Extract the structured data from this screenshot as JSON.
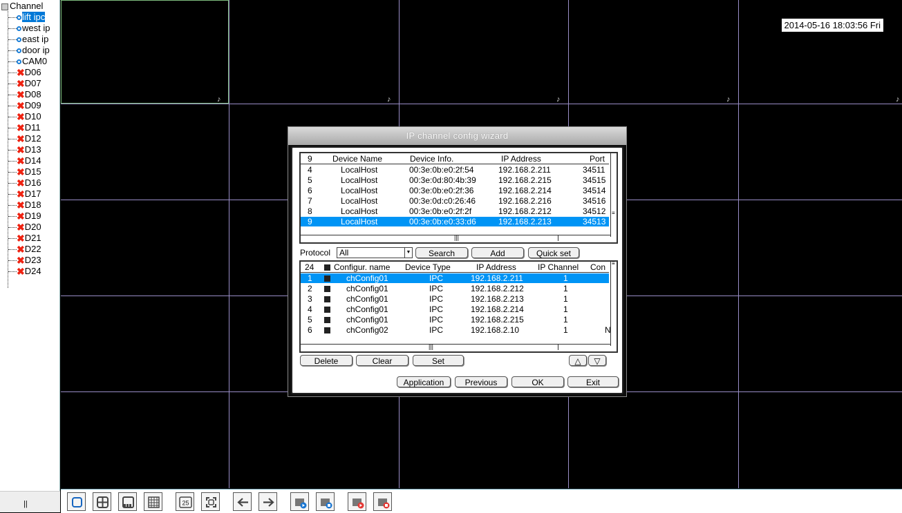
{
  "sidebar": {
    "root_label": "Channel",
    "channels": [
      {
        "label": "lift ipc",
        "type": "ipc",
        "selected": true
      },
      {
        "label": "west ip",
        "type": "ipc"
      },
      {
        "label": "east ip",
        "type": "ipc"
      },
      {
        "label": "door ip",
        "type": "ipc"
      },
      {
        "label": "CAM0",
        "type": "ipc"
      },
      {
        "label": "D06",
        "type": "off"
      },
      {
        "label": "D07",
        "type": "off"
      },
      {
        "label": "D08",
        "type": "off"
      },
      {
        "label": "D09",
        "type": "off"
      },
      {
        "label": "D10",
        "type": "off"
      },
      {
        "label": "D11",
        "type": "off"
      },
      {
        "label": "D12",
        "type": "off"
      },
      {
        "label": "D13",
        "type": "off"
      },
      {
        "label": "D14",
        "type": "off"
      },
      {
        "label": "D15",
        "type": "off"
      },
      {
        "label": "D16",
        "type": "off"
      },
      {
        "label": "D17",
        "type": "off"
      },
      {
        "label": "D18",
        "type": "off"
      },
      {
        "label": "D19",
        "type": "off"
      },
      {
        "label": "D20",
        "type": "off"
      },
      {
        "label": "D21",
        "type": "off"
      },
      {
        "label": "D22",
        "type": "off"
      },
      {
        "label": "D23",
        "type": "off"
      },
      {
        "label": "D24",
        "type": "off"
      }
    ]
  },
  "video": {
    "datetime": "2014-05-16 18:03:56 Fri"
  },
  "dialog": {
    "title": "IP channel config wizard",
    "search_table": {
      "count": "9",
      "headers": [
        "Device Name",
        "Device Info.",
        "IP Address",
        "Port"
      ],
      "rows": [
        {
          "no": "4",
          "name": "LocalHost",
          "info": "00:3e:0b:e0:2f:54",
          "ip": "192.168.2.211",
          "port": "34511"
        },
        {
          "no": "5",
          "name": "LocalHost",
          "info": "00:3e:0d:80:4b:39",
          "ip": "192.168.2.215",
          "port": "34515"
        },
        {
          "no": "6",
          "name": "LocalHost",
          "info": "00:3e:0b:e0:2f:36",
          "ip": "192.168.2.214",
          "port": "34514"
        },
        {
          "no": "7",
          "name": "LocalHost",
          "info": "00:3e:0d:c0:26:46",
          "ip": "192.168.2.216",
          "port": "34516"
        },
        {
          "no": "8",
          "name": "LocalHost",
          "info": "00:3e:0b:e0:2f:2f",
          "ip": "192.168.2.212",
          "port": "34512"
        },
        {
          "no": "9",
          "name": "LocalHost",
          "info": "00:3e:0b:e0:33:d6",
          "ip": "192.168.2.213",
          "port": "34513",
          "selected": true
        }
      ]
    },
    "protocol_label": "Protocol",
    "protocol_value": "All",
    "search_label": "Search",
    "add_label": "Add",
    "quickset_label": "Quick set",
    "config_table": {
      "count": "24",
      "headers": [
        "Configur. name",
        "Device Type",
        "IP Address",
        "IP Channel",
        "Con"
      ],
      "rows": [
        {
          "no": "1",
          "name": "chConfig01",
          "type": "IPC",
          "ip": "192.168.2.211",
          "ch": "1",
          "con": "",
          "selected": true
        },
        {
          "no": "2",
          "name": "chConfig01",
          "type": "IPC",
          "ip": "192.168.2.212",
          "ch": "1",
          "con": ""
        },
        {
          "no": "3",
          "name": "chConfig01",
          "type": "IPC",
          "ip": "192.168.2.213",
          "ch": "1",
          "con": ""
        },
        {
          "no": "4",
          "name": "chConfig01",
          "type": "IPC",
          "ip": "192.168.2.214",
          "ch": "1",
          "con": ""
        },
        {
          "no": "5",
          "name": "chConfig01",
          "type": "IPC",
          "ip": "192.168.2.215",
          "ch": "1",
          "con": ""
        },
        {
          "no": "6",
          "name": "chConfig02",
          "type": "IPC",
          "ip": "192.168.2.10",
          "ch": "1",
          "con": "N"
        }
      ]
    },
    "delete_label": "Delete",
    "clear_label": "Clear",
    "set_label": "Set",
    "application_label": "Application",
    "previous_label": "Previous",
    "ok_label": "OK",
    "exit_label": "Exit"
  },
  "toolbar": {
    "buttons": [
      {
        "icon": "single-view-icon"
      },
      {
        "icon": "quad-view-icon"
      },
      {
        "icon": "eight-view-icon"
      },
      {
        "icon": "sixteen-view-icon"
      },
      {
        "icon": "twentyfive-view-icon",
        "text": "25"
      },
      {
        "icon": "fullscreen-icon"
      },
      {
        "icon": "previous-page-icon"
      },
      {
        "icon": "next-page-icon"
      },
      {
        "icon": "start-playback-icon"
      },
      {
        "icon": "stop-playback-icon"
      },
      {
        "icon": "start-record-icon"
      },
      {
        "icon": "stop-record-icon"
      }
    ]
  },
  "colors": {
    "selection": "#0094f5",
    "grid_line": "#9a8ec8",
    "disconnected": "#ee2211",
    "connected": "#1a7fd8"
  }
}
